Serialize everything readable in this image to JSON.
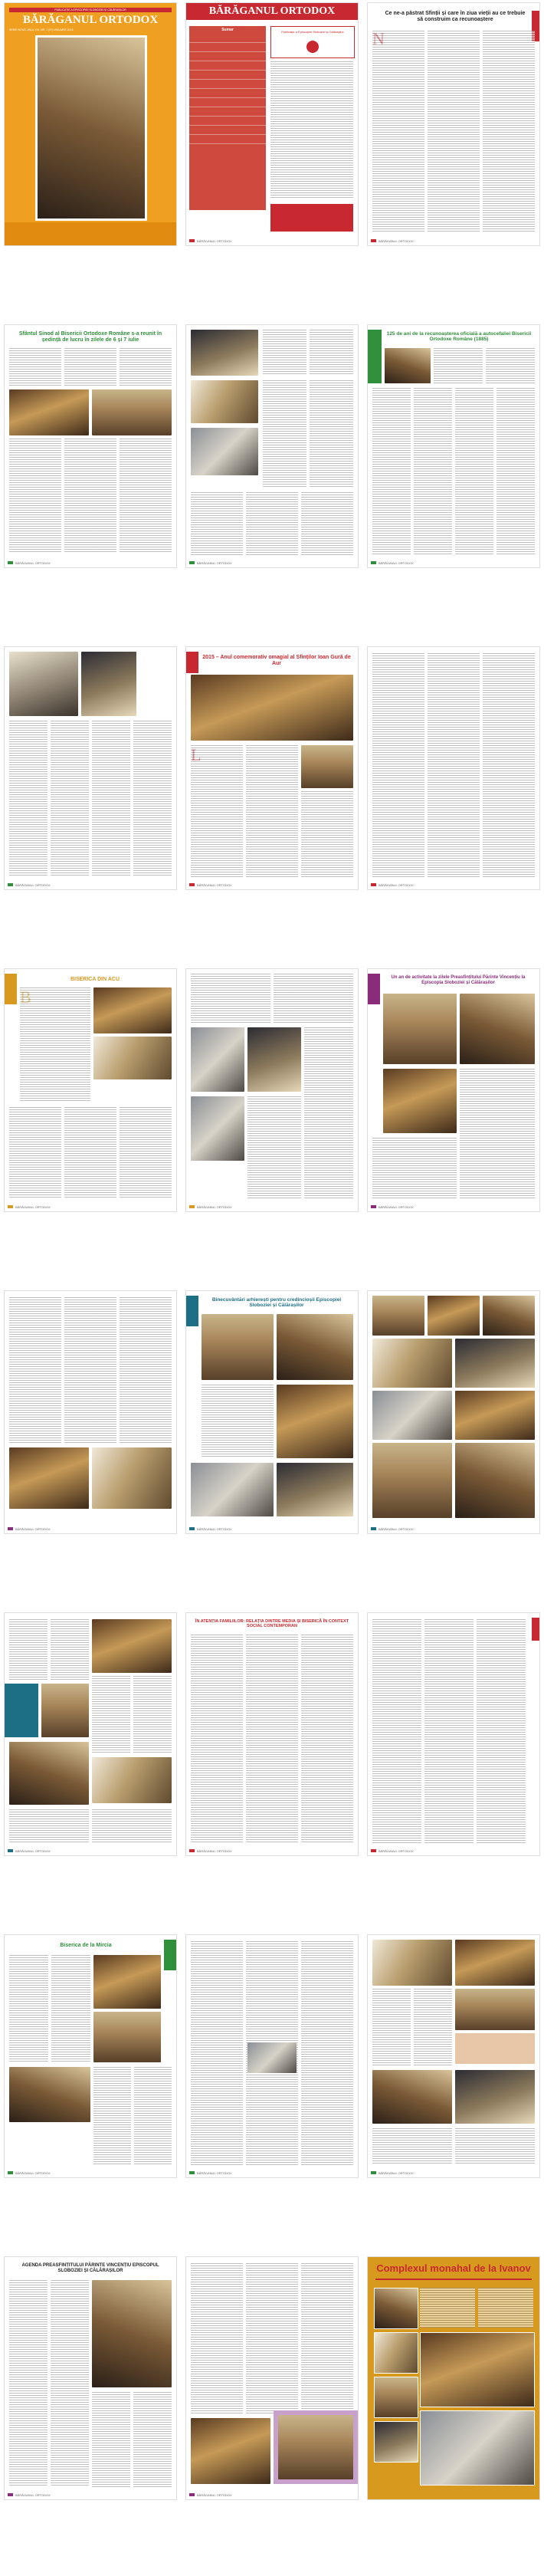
{
  "magazine": {
    "name": "BĂRĂGANUL ORTODOX",
    "cover_banner": "PUBLICAȚIE A EPISCOPIEI SLOBOZIEI ȘI CĂLĂRAȘILOR",
    "cover_subtitle": "SERIE NOUĂ, ANUL XIX, NR. 1 (97) IANUARIE 2015",
    "footer_label": "BĂRĂGANUL ORTODOX"
  },
  "page2": {
    "contents_heading": "Sumar",
    "masthead_title": "BĂRĂGANUL ORTODOX",
    "imprint_note": "Publicaţie a Episcopiei Sloboziei şi Călăraşilor"
  },
  "page3": {
    "headline": "Ce ne-a păstrat Sfinții și care în ziua vieții au ce trebuie să construim ca recunoaștere"
  },
  "page5": {
    "headline": "Sfântul Sinod al Bisericii Ortodoxe Române s-a reunit în ședință de lucru în zilele de 6 și 7 iulie"
  },
  "page7": {
    "headline": "125 de ani de la recunoașterea oficială a autocefaliei Bisericii Ortodoxe Române (1885)"
  },
  "page11": {
    "headline": "2015 – Anul comemorativ omagial al Sfinților Ioan Gură de Aur"
  },
  "page13": {
    "headline": "BISERICA DIN ACU"
  },
  "page15": {
    "headline": "Un an de activitate la zilele Preasfințitului Părinte Vincențiu la Episcopia Sloboziei și Călărașilor"
  },
  "page17": {
    "headline": "Binecuvântări arhierești pentru credincioșii Episcopiei Sloboziei și Călărașilor"
  },
  "page20": {
    "headline": "ÎN ATENȚIA FAMILIILOR: RELAȚIA DINTRE MEDIA ȘI BISERICĂ ÎN CONTEXT SOCIAL CONTEMPORAN"
  },
  "page22": {
    "headline": "Biserica de la Mircia"
  },
  "page25": {
    "headline": "AGENDA PREASFINȚITULUI PĂRINTE VINCENȚIU EPISCOPUL SLOBOZIEI ȘI CĂLĂRAȘILOR"
  },
  "page28": {
    "headline": "Complexul monahal de la Ivanov"
  },
  "colors": {
    "cover_orange": "#f0a020",
    "masthead_red": "#c8282f",
    "green": "#2f8f3a",
    "teal": "#1d6f86",
    "purple": "#8a2c7a",
    "ochre": "#d79a1e"
  }
}
